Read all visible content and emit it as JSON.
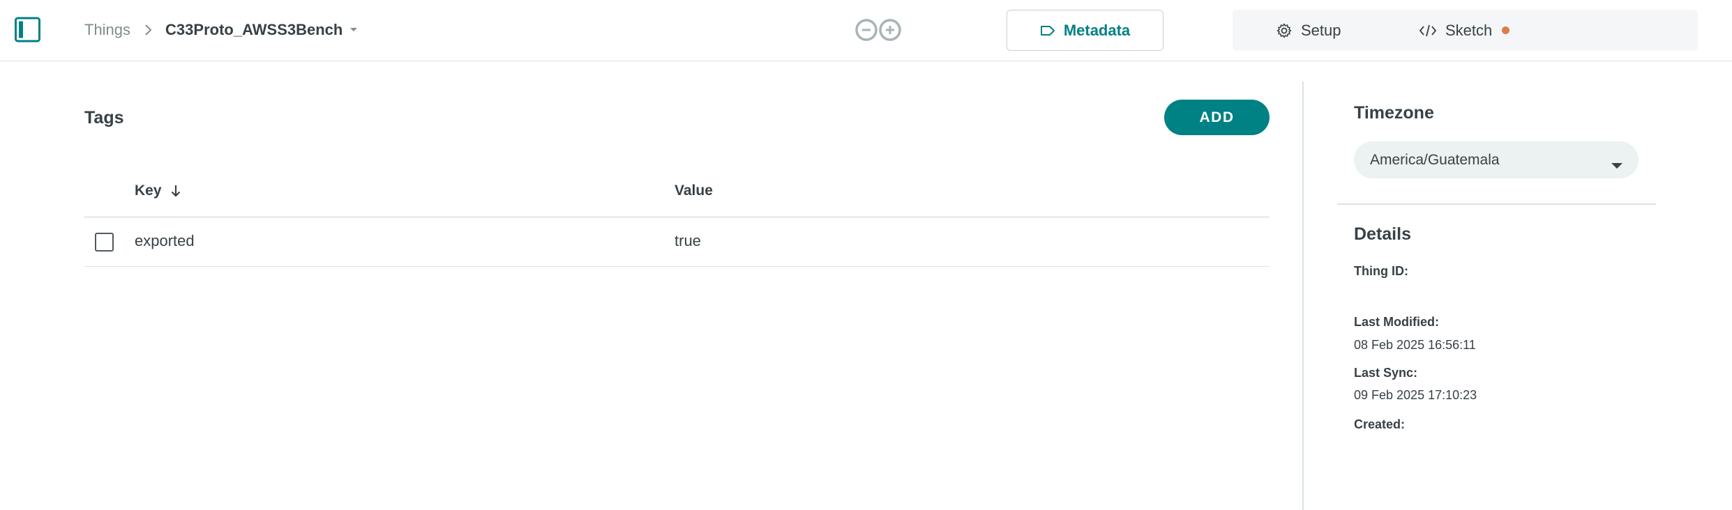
{
  "header": {
    "breadcrumb_parent": "Things",
    "breadcrumb_current": "C33Proto_AWSS3Bench",
    "tabs": {
      "setup": "Setup",
      "sketch": "Sketch",
      "metadata": "Metadata"
    }
  },
  "tags": {
    "title": "Tags",
    "add_label": "ADD",
    "columns": {
      "key": "Key",
      "value": "Value"
    },
    "rows": [
      {
        "key": "exported",
        "value": "true"
      }
    ]
  },
  "timezone": {
    "title": "Timezone",
    "selected": "America/Guatemala"
  },
  "details": {
    "title": "Details",
    "thing_id_label": "Thing ID:",
    "thing_id_value": "",
    "last_modified_label": "Last Modified:",
    "last_modified_value": "08 Feb 2025 16:56:11",
    "last_sync_label": "Last Sync:",
    "last_sync_value": "09 Feb 2025 17:10:23",
    "created_label": "Created:",
    "created_value": ""
  },
  "colors": {
    "accent": "#008184",
    "sketch_status_dot": "#d97d4a",
    "text": "#374146",
    "muted_text": "#7f8c8d"
  },
  "icons": {
    "sidebar_toggle": "sidebar-toggle-icon",
    "breadcrumb_separator": "chevron-right-icon",
    "breadcrumb_dropdown": "caret-down-icon",
    "brand": "arduino-logo-icon",
    "setup": "gear-icon",
    "sketch": "code-icon",
    "metadata": "tag-icon",
    "sort": "arrow-down-icon",
    "timezone_dropdown": "caret-down-icon"
  }
}
